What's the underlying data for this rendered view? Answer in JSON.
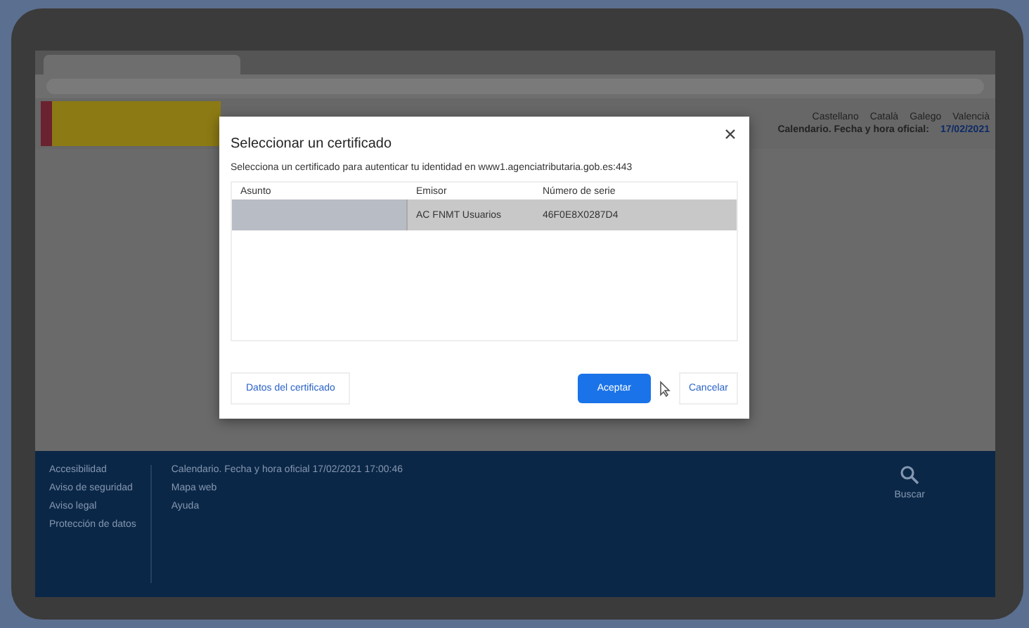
{
  "header": {
    "languages": [
      "Castellano",
      "Català",
      "Galego",
      "Valencià"
    ],
    "calendar_label": "Calendario. Fecha y hora oficial:",
    "calendar_value": "17/02/2021"
  },
  "dialog": {
    "title": "Seleccionar un certificado",
    "message": "Selecciona un certificado para autenticar tu identidad en www1.agenciatributaria.gob.es:443",
    "columns": [
      "Asunto",
      "Emisor",
      "Número de serie"
    ],
    "rows": [
      {
        "emisor": "AC FNMT Usuarios",
        "serial": "46F0E8X0287D4",
        "selected": true
      }
    ],
    "details_button": "Datos del certificado",
    "accept_button": "Aceptar",
    "cancel_button": "Cancelar"
  },
  "footer": {
    "column_1": [
      "Accesibilidad",
      "Aviso de seguridad",
      "Aviso legal",
      "Protección de datos"
    ],
    "column_2": [
      "Calendario. Fecha y hora oficial 17/02/2021 17:00:46",
      "Mapa web",
      "Ayuda"
    ],
    "search_label": "Buscar"
  }
}
